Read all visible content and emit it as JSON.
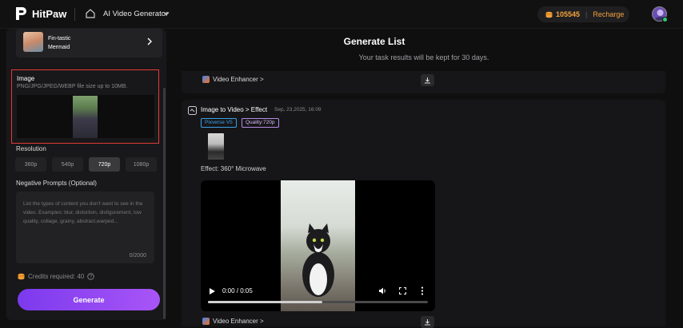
{
  "header": {
    "brand": "HitPaw",
    "app_title": "AI Video Generator",
    "credits": "105545",
    "recharge_label": "Recharge",
    "accent": "#f4a23c"
  },
  "sidebar": {
    "preset_name": "Fin-tastic Mermaid",
    "image_label": "Image",
    "image_hint": "PNG/JPG/JPEG/WEBP file size up to 10MB.",
    "resolution_label": "Resolution",
    "resolutions": [
      "360p",
      "540p",
      "720p",
      "1080p"
    ],
    "selected_resolution": "720p",
    "negative_label": "Negative Prompts (Optional)",
    "negative_placeholder": "List the types of content you don't want to see in the video. Examples: blur, distortion, disfigurement, low quality, collage, grainy, abstract,warped...",
    "negative_count": "0/2000",
    "credits_required": "Credits required: 40",
    "generate_label": "Generate",
    "generate_color": "#8b45f0"
  },
  "main": {
    "title": "Generate List",
    "subtitle": "Your task results will be kept for 30 days.",
    "enhancer_label": "Video Enhancer >",
    "task": {
      "title": "Image to Video > Effect",
      "date": "Sep, 23,2025, 16:09",
      "tag_model": "Pixverse V5",
      "tag_quality": "Quality:720p",
      "effect": "Effect: 360° Microwave",
      "time": "0:00 / 0:05",
      "progress": 0.52
    }
  }
}
